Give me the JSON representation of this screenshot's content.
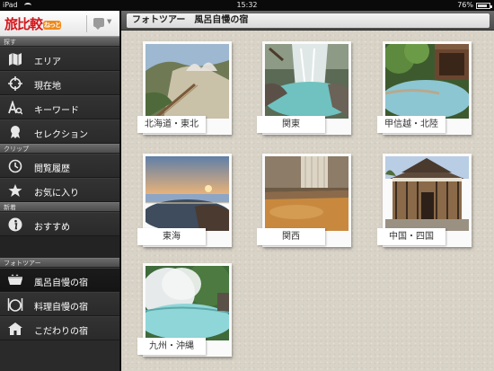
{
  "status_bar": {
    "device": "iPad",
    "time": "15:32",
    "battery": "76%",
    "battery_level": 0.76
  },
  "sidebar": {
    "logo": "旅比較ねっと",
    "sections": [
      {
        "header": "探す",
        "items": [
          {
            "label": "エリア",
            "icon": "map-icon"
          },
          {
            "label": "現在地",
            "icon": "crosshair-icon"
          },
          {
            "label": "キーワード",
            "icon": "keyword-icon"
          },
          {
            "label": "セレクション",
            "icon": "award-icon"
          }
        ]
      },
      {
        "header": "クリップ",
        "items": [
          {
            "label": "閲覧履歴",
            "icon": "clock-icon"
          },
          {
            "label": "お気に入り",
            "icon": "star-icon"
          }
        ]
      },
      {
        "header": "新着",
        "items": [
          {
            "label": "おすすめ",
            "icon": "info-icon"
          }
        ]
      },
      {
        "header": "フォトツアー",
        "items": [
          {
            "label": "風呂自慢の宿",
            "icon": "bath-icon",
            "active": true
          },
          {
            "label": "料理自慢の宿",
            "icon": "dining-icon"
          },
          {
            "label": "こだわりの宿",
            "icon": "inn-icon"
          }
        ]
      }
    ]
  },
  "main": {
    "title": "フォトツアー　風呂自慢の宿",
    "cards": [
      {
        "label": "北海道・東北"
      },
      {
        "label": "関東"
      },
      {
        "label": "甲信越・北陸"
      },
      {
        "label": "東海"
      },
      {
        "label": "関西"
      },
      {
        "label": "中国・四国"
      },
      {
        "label": "九州・沖縄"
      }
    ]
  }
}
